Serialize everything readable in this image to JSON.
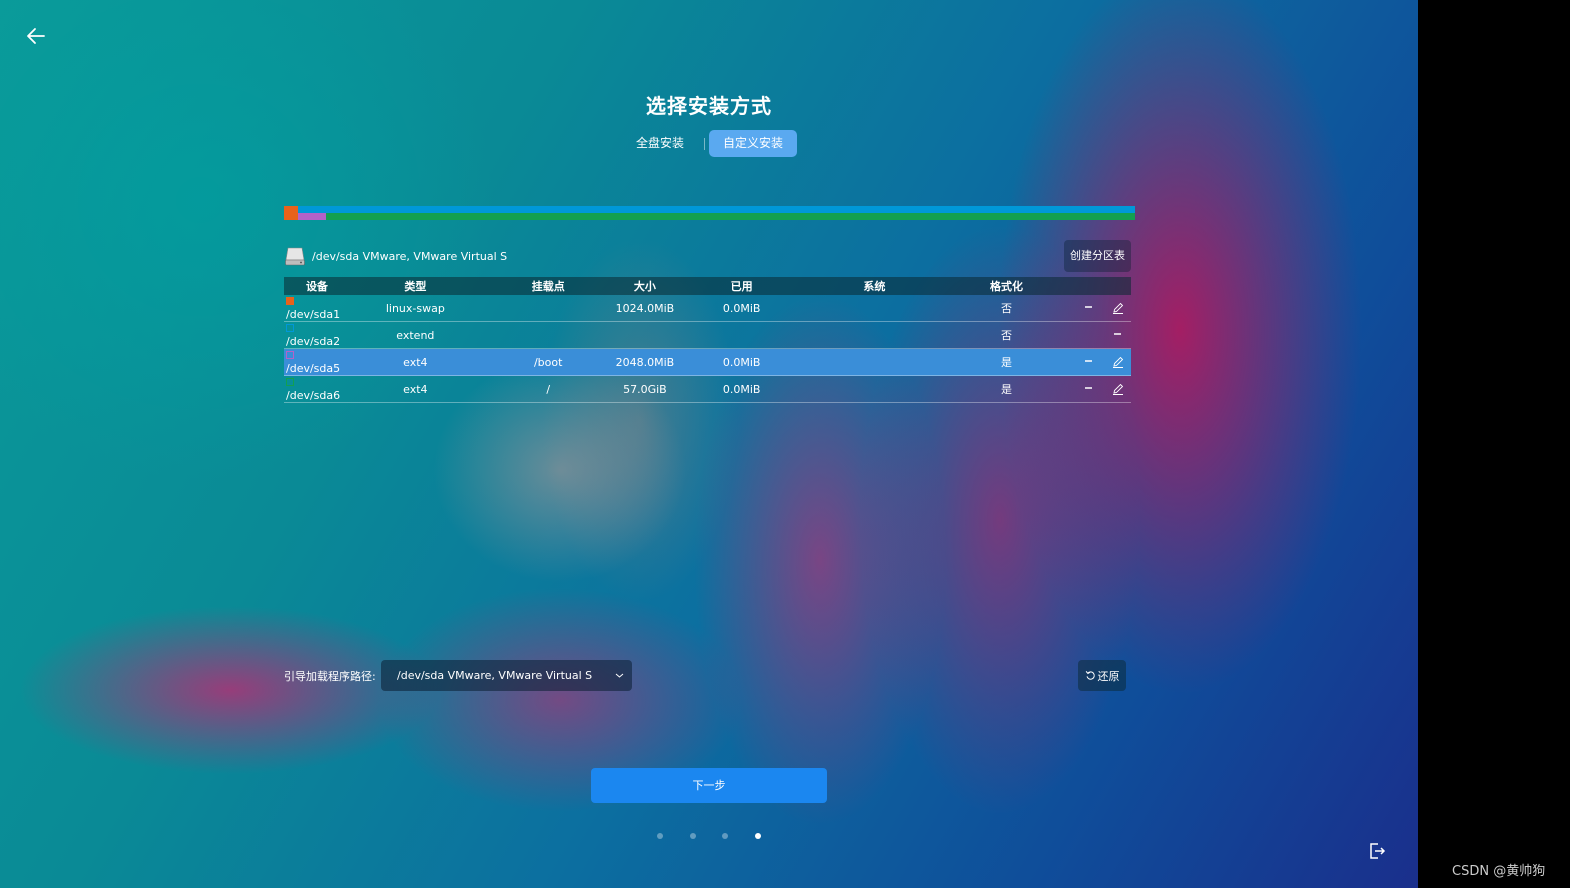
{
  "header": {
    "title": "选择安装方式",
    "tabs": [
      {
        "label": "全盘安装",
        "active": false
      },
      {
        "label": "自定义安装",
        "active": true
      }
    ]
  },
  "partition_bar": {
    "segments": [
      {
        "device": "/dev/sda1",
        "color": "#e8621a"
      },
      {
        "device": "/dev/sda2",
        "color": "#0098d8"
      },
      {
        "device": "/dev/sda5",
        "color": "#b462c8"
      },
      {
        "device": "/dev/sda6",
        "color": "#13a050"
      }
    ]
  },
  "disk": {
    "icon": "hard-drive-icon",
    "label": "/dev/sda VMware, VMware Virtual S",
    "create_table_button": "创建分区表"
  },
  "table": {
    "headers": [
      "设备",
      "类型",
      "挂载点",
      "大小",
      "已用",
      "系统",
      "格式化"
    ],
    "rows": [
      {
        "device": "/dev/sda1",
        "color": "#e8621a",
        "type": "linux-swap",
        "mount": "",
        "size": "1024.0MiB",
        "used": "0.0MiB",
        "system": "",
        "format": "否",
        "selected": false
      },
      {
        "device": "/dev/sda2",
        "color": "#0098d8",
        "type": "extend",
        "mount": "",
        "size": "",
        "used": "",
        "system": "",
        "format": "否",
        "selected": false
      },
      {
        "device": "/dev/sda5",
        "color": "#b462c8",
        "type": "ext4",
        "mount": "/boot",
        "size": "2048.0MiB",
        "used": "0.0MiB",
        "system": "",
        "format": "是",
        "selected": true
      },
      {
        "device": "/dev/sda6",
        "color": "#13a050",
        "type": "ext4",
        "mount": "/",
        "size": "57.0GiB",
        "used": "0.0MiB",
        "system": "",
        "format": "是",
        "selected": false
      }
    ]
  },
  "bootloader": {
    "label": "引导加载程序路径:",
    "value": "/dev/sda VMware, VMware Virtual S"
  },
  "restore_button": "还原",
  "next_button": "下一步",
  "pagination": {
    "count": 4,
    "active_index": 3
  },
  "watermark": "CSDN @黄帅狗"
}
